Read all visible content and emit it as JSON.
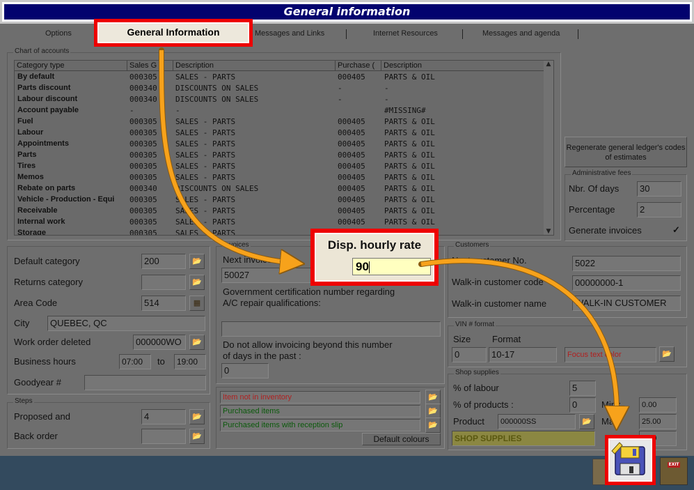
{
  "window": {
    "title": "General information"
  },
  "tabs": [
    {
      "label": "Options"
    },
    {
      "label": "General Information"
    },
    {
      "label": "Messages and Links"
    },
    {
      "label": "Internet Resources"
    },
    {
      "label": "Messages and agenda"
    }
  ],
  "chart_of_accounts": {
    "label": "Chart of accounts",
    "columns": [
      "Category type",
      "Sales G",
      "Description",
      "Purchase (",
      "Description"
    ],
    "rows": [
      [
        "By default",
        "000305",
        "SALES - PARTS",
        "000405",
        "PARTS & OIL"
      ],
      [
        "Parts discount",
        "000340",
        "DISCOUNTS ON SALES",
        "-",
        "-"
      ],
      [
        "Labour discount",
        "000340",
        "DISCOUNTS ON SALES",
        "-",
        "-"
      ],
      [
        "Account payable",
        "-",
        "-",
        "",
        "#MISSING#"
      ],
      [
        "Fuel",
        "000305",
        "SALES - PARTS",
        "000405",
        "PARTS & OIL"
      ],
      [
        "Labour",
        "000305",
        "SALES - PARTS",
        "000405",
        "PARTS & OIL"
      ],
      [
        "Appointments",
        "000305",
        "SALES - PARTS",
        "000405",
        "PARTS & OIL"
      ],
      [
        "Parts",
        "000305",
        "SALES - PARTS",
        "000405",
        "PARTS & OIL"
      ],
      [
        "Tires",
        "000305",
        "SALES - PARTS",
        "000405",
        "PARTS & OIL"
      ],
      [
        "Memos",
        "000305",
        "SALES - PARTS",
        "000405",
        "PARTS & OIL"
      ],
      [
        "Rebate on parts",
        "000340",
        "DISCOUNTS ON SALES",
        "000405",
        "PARTS & OIL"
      ],
      [
        "Vehicle - Production - Equi",
        "000305",
        "SALES - PARTS",
        "000405",
        "PARTS & OIL"
      ],
      [
        "Receivable",
        "000305",
        "SALES - PARTS",
        "000405",
        "PARTS & OIL"
      ],
      [
        "Internal work",
        "000305",
        "SALES - PARTS",
        "000405",
        "PARTS & OIL"
      ],
      [
        "Storage",
        "000305",
        "SALES - PARTS",
        "000405",
        "PARTS & OIL"
      ]
    ]
  },
  "regenerate_button": {
    "line1": "Regenerate general ledger's codes",
    "line2": "of estimates"
  },
  "admin_fees": {
    "label": "Administrative fees",
    "nbr_days_label": "Nbr. Of days",
    "nbr_days_value": "30",
    "percentage_label": "Percentage",
    "percentage_value": "2",
    "generate_label": "Generate invoices",
    "generate_check": "✓"
  },
  "general": {
    "default_category_label": "Default category",
    "default_category_value": "200",
    "returns_category_label": "Returns category",
    "returns_category_value": "",
    "area_code_label": "Area Code",
    "area_code_value": "514",
    "city_label": "City",
    "city_value": "QUEBEC, QC",
    "wo_deleted_label": "Work order deleted",
    "wo_deleted_value": "000000WO",
    "business_hours_label": "Business hours",
    "hours_from": "07:00",
    "hours_to_label": "to",
    "hours_to": "19:00",
    "goodyear_label": "Goodyear #",
    "goodyear_value": ""
  },
  "steps": {
    "label": "Steps",
    "proposed_label": "Proposed and",
    "proposed_value": "4",
    "back_order_label": "Back order",
    "back_order_value": ""
  },
  "invoices": {
    "label": "Invoices",
    "next_invoice_label": "Next invoice",
    "next_invoice_value": "50027",
    "gov_cert_label_1": "Government certification number regarding",
    "gov_cert_label_2": "A/C repair qualifications:",
    "gov_cert_value": "",
    "no_invoicing_label_1": "Do not allow invoicing beyond this number",
    "no_invoicing_label_2": "of days in the past :",
    "no_invoicing_value": "0"
  },
  "colours": {
    "item_not_in_inventory": "Item not in inventory",
    "purchased_items": "Purchased items",
    "purchased_with_slip": "Purchased items with reception slip",
    "default_colours_button": "Default colours",
    "red": "#b02020",
    "green": "#0b5a0b"
  },
  "customers": {
    "label": "Customers",
    "next_no_label": "Next customer No.",
    "next_no_value": "5022",
    "walkin_code_label": "Walk-in customer code",
    "walkin_code_value": "00000000-1",
    "walkin_name_label": "Walk-in customer name",
    "walkin_name_value": "WALK-IN CUSTOMER"
  },
  "vin": {
    "label": "VIN # format",
    "size_label": "Size",
    "size_value": "0",
    "format_label": "Format",
    "format_value": "10-17",
    "focus_label": "Focus text color"
  },
  "shop_supplies": {
    "label": "Shop supplies",
    "pct_labour_label": "% of labour",
    "pct_labour_value": "5",
    "pct_products_label": "% of products :",
    "pct_products_value": "0",
    "min_label": "Min :",
    "min_value": "0.00",
    "max_label": "Max",
    "max_value": "25.00",
    "product_label": "Product",
    "product_value": "000000SS",
    "product_desc": "SHOP SUPPLIES",
    "extra_value": "0.00"
  },
  "callout": {
    "label": "Disp. hourly rate",
    "value": "90"
  },
  "footer": {
    "print_icon": "printer-icon",
    "save_icon": "floppy-disk-icon",
    "exit_label": "EXIT",
    "exit_icon": "exit-door-icon"
  },
  "accent": {
    "highlight": "#ff0000",
    "arrow": "#f7a21b",
    "title_bg": "#02026e"
  }
}
